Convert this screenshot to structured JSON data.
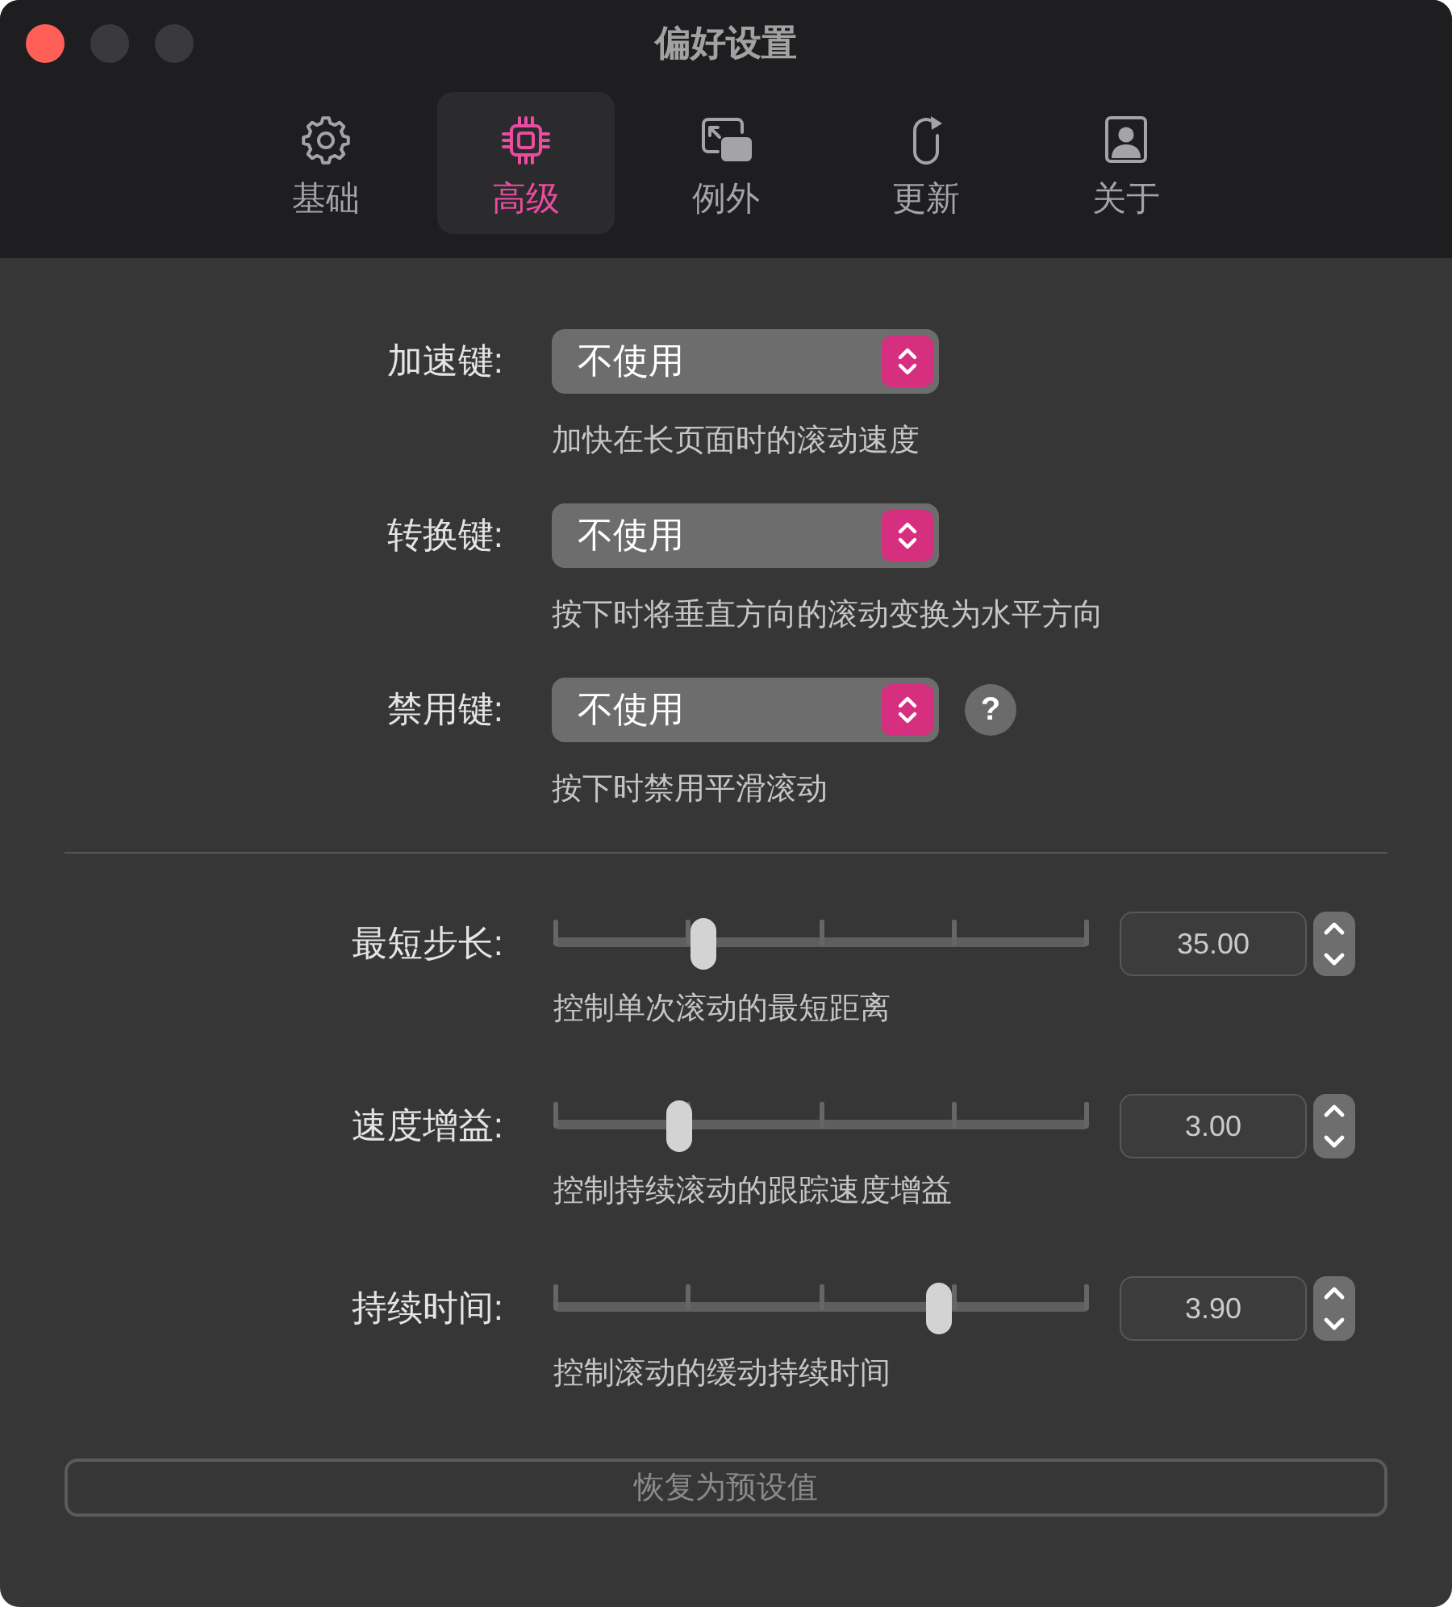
{
  "window": {
    "title": "偏好设置"
  },
  "tabs": [
    {
      "label": "基础",
      "selected": false
    },
    {
      "label": "高级",
      "selected": true
    },
    {
      "label": "例外",
      "selected": false
    },
    {
      "label": "更新",
      "selected": false
    },
    {
      "label": "关于",
      "selected": false
    }
  ],
  "key_settings": [
    {
      "label": "加速键:",
      "value": "不使用",
      "description": "加快在长页面时的滚动速度"
    },
    {
      "label": "转换键:",
      "value": "不使用",
      "description": "按下时将垂直方向的滚动变换为水平方向"
    },
    {
      "label": "禁用键:",
      "value": "不使用",
      "help_button": "?",
      "description": "按下时禁用平滑滚动"
    }
  ],
  "sliders": [
    {
      "label": "最短步长:",
      "level": 0.27,
      "value": "35.00",
      "description": "控制单次滚动的最短距离"
    },
    {
      "label": "速度增益:",
      "level": 0.22,
      "value": "3.00",
      "description": "控制持续滚动的跟踪速度增益"
    },
    {
      "label": "持续时间:",
      "level": 0.73,
      "value": "3.90",
      "description": "控制滚动的缓动持续时间"
    }
  ],
  "reset_button": {
    "label": "恢复为预设值",
    "disabled": true
  }
}
